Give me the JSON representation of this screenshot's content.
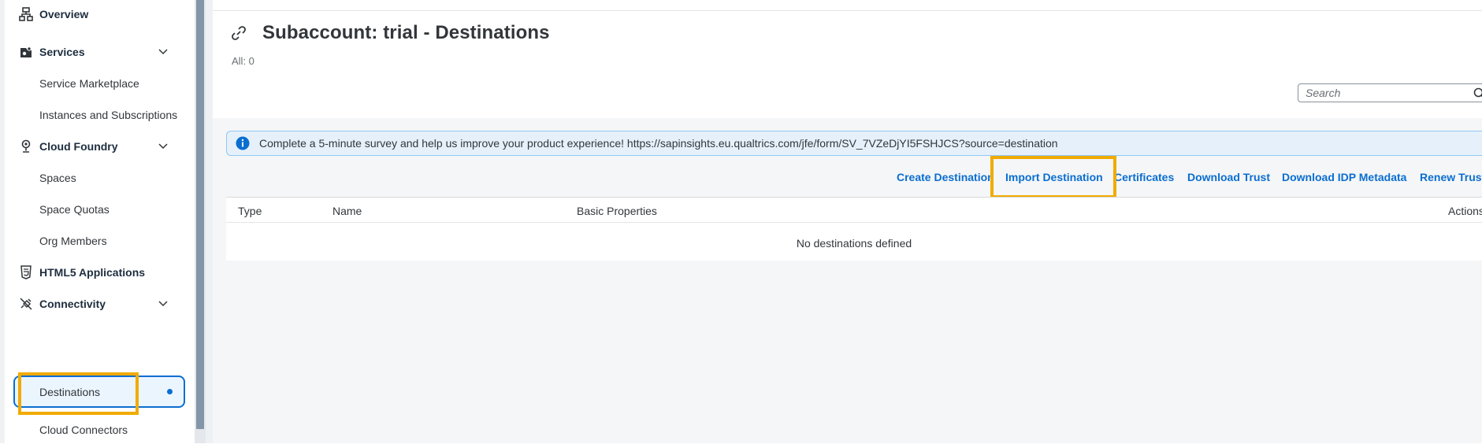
{
  "sidebar": {
    "items": [
      {
        "label": "Overview",
        "icon": "hierarchy-icon",
        "level": "top"
      },
      {
        "label": "Services",
        "icon": "services-icon",
        "level": "top",
        "expandable": true
      },
      {
        "label": "Service Marketplace",
        "level": "sub"
      },
      {
        "label": "Instances and Subscriptions",
        "level": "sub"
      },
      {
        "label": "Cloud Foundry",
        "icon": "cloud-foundry-icon",
        "level": "top",
        "expandable": true
      },
      {
        "label": "Spaces",
        "level": "sub"
      },
      {
        "label": "Space Quotas",
        "level": "sub"
      },
      {
        "label": "Org Members",
        "level": "sub"
      },
      {
        "label": "HTML5 Applications",
        "icon": "html5-icon",
        "level": "top"
      },
      {
        "label": "Connectivity",
        "icon": "connectivity-icon",
        "level": "top",
        "expandable": true
      },
      {
        "label": "Destinations",
        "level": "sub",
        "selected": true
      },
      {
        "label": "Cloud Connectors",
        "level": "sub"
      }
    ]
  },
  "main": {
    "title": "Subaccount: trial - Destinations",
    "count_label": "All: 0",
    "search_placeholder": "Search",
    "banner_text": "Complete a 5-minute survey and help us improve your product experience! https://sapinsights.eu.qualtrics.com/jfe/form/SV_7VZeDjYI5FSHJCS?source=destination",
    "toolbar": {
      "create": "Create Destination",
      "import": "Import Destination",
      "certificates": "Certificates",
      "download_trust": "Download Trust",
      "download_idp": "Download IDP Metadata",
      "renew_trust": "Renew Trust"
    },
    "table": {
      "columns": [
        "Type",
        "Name",
        "Basic Properties",
        "Actions"
      ],
      "empty_message": "No destinations defined"
    }
  },
  "colors": {
    "accent": "#0a6ed1",
    "highlight": "#f0ab00",
    "banner_bg": "#e5f0fa"
  }
}
